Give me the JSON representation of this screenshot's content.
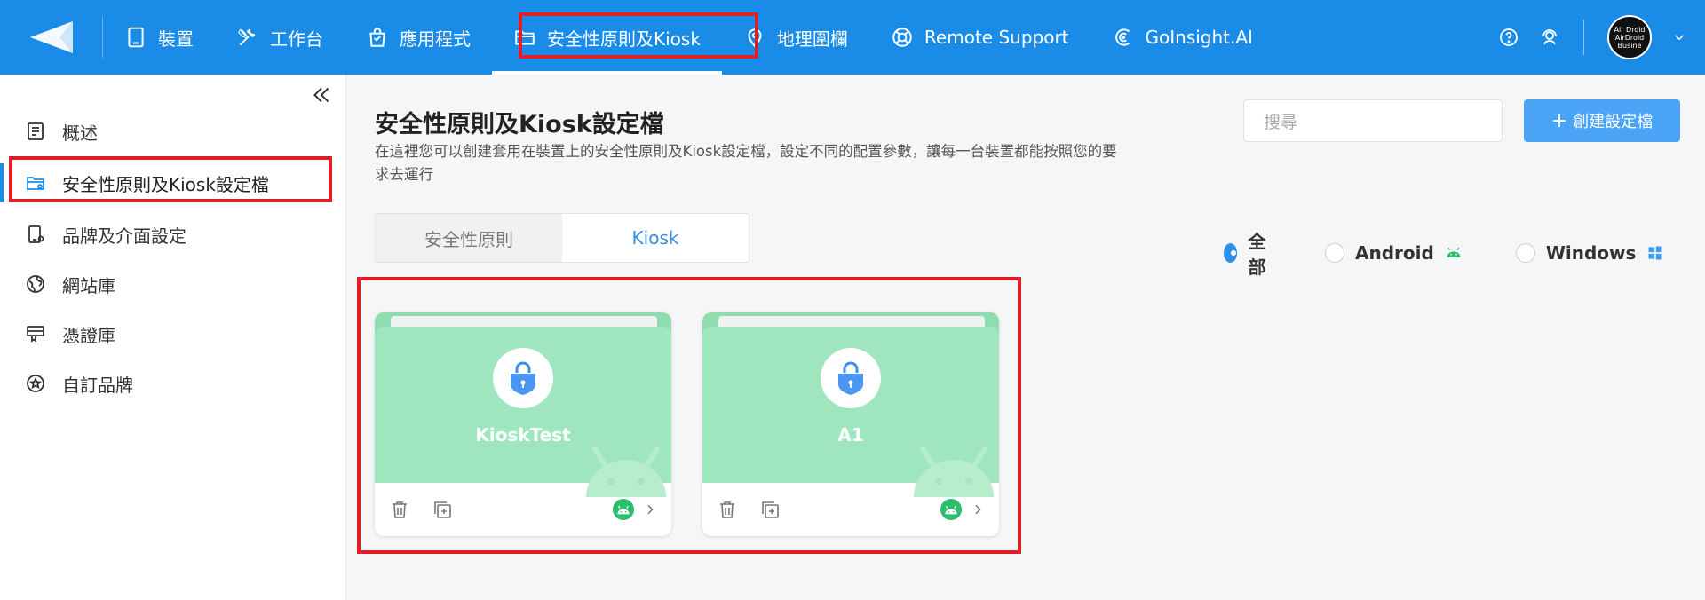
{
  "topbar": {
    "nav": [
      {
        "label": "裝置",
        "icon": "tablet-icon"
      },
      {
        "label": "工作台",
        "icon": "tools-icon"
      },
      {
        "label": "應用程式",
        "icon": "shopping-bag-icon"
      },
      {
        "label": "安全性原則及Kiosk",
        "icon": "folder-icon",
        "active": true
      },
      {
        "label": "地理圍欄",
        "icon": "location-icon"
      },
      {
        "label": "Remote Support",
        "icon": "lifebuoy-icon"
      },
      {
        "label": "GoInsight.AI",
        "icon": "insight-icon"
      }
    ],
    "avatar_text": "Air Droid AirDroid Busine"
  },
  "sidebar": {
    "items": [
      {
        "label": "概述",
        "icon": "overview-icon"
      },
      {
        "label": "安全性原則及Kiosk設定檔",
        "icon": "policy-folder-icon",
        "active": true
      },
      {
        "label": "品牌及介面設定",
        "icon": "device-settings-icon"
      },
      {
        "label": "網站庫",
        "icon": "globe-icon"
      },
      {
        "label": "憑證庫",
        "icon": "certificate-icon"
      },
      {
        "label": "自訂品牌",
        "icon": "star-badge-icon"
      }
    ]
  },
  "main": {
    "title": "安全性原則及Kiosk設定檔",
    "description": "在這裡您可以創建套用在裝置上的安全性原則及Kiosk設定檔，設定不同的配置參數，讓每一台裝置都能按照您的要求去運行",
    "search_placeholder": "搜尋",
    "create_button": "創建設定檔",
    "create_button_icon": "+",
    "tabs": [
      "安全性原則",
      "Kiosk"
    ],
    "active_tab": "Kiosk",
    "filters": [
      {
        "label": "全部",
        "selected": true
      },
      {
        "label": "Android",
        "icon": "android-icon"
      },
      {
        "label": "Windows",
        "icon": "windows-icon"
      }
    ],
    "cards": [
      {
        "name": "KioskTest",
        "platform": "android"
      },
      {
        "name": "A1",
        "platform": "android"
      }
    ]
  },
  "colors": {
    "brand_blue": "#1a8ce8",
    "card_green": "#9fe6be",
    "android_green": "#2dbd6e",
    "highlight_red": "#e01e25"
  }
}
